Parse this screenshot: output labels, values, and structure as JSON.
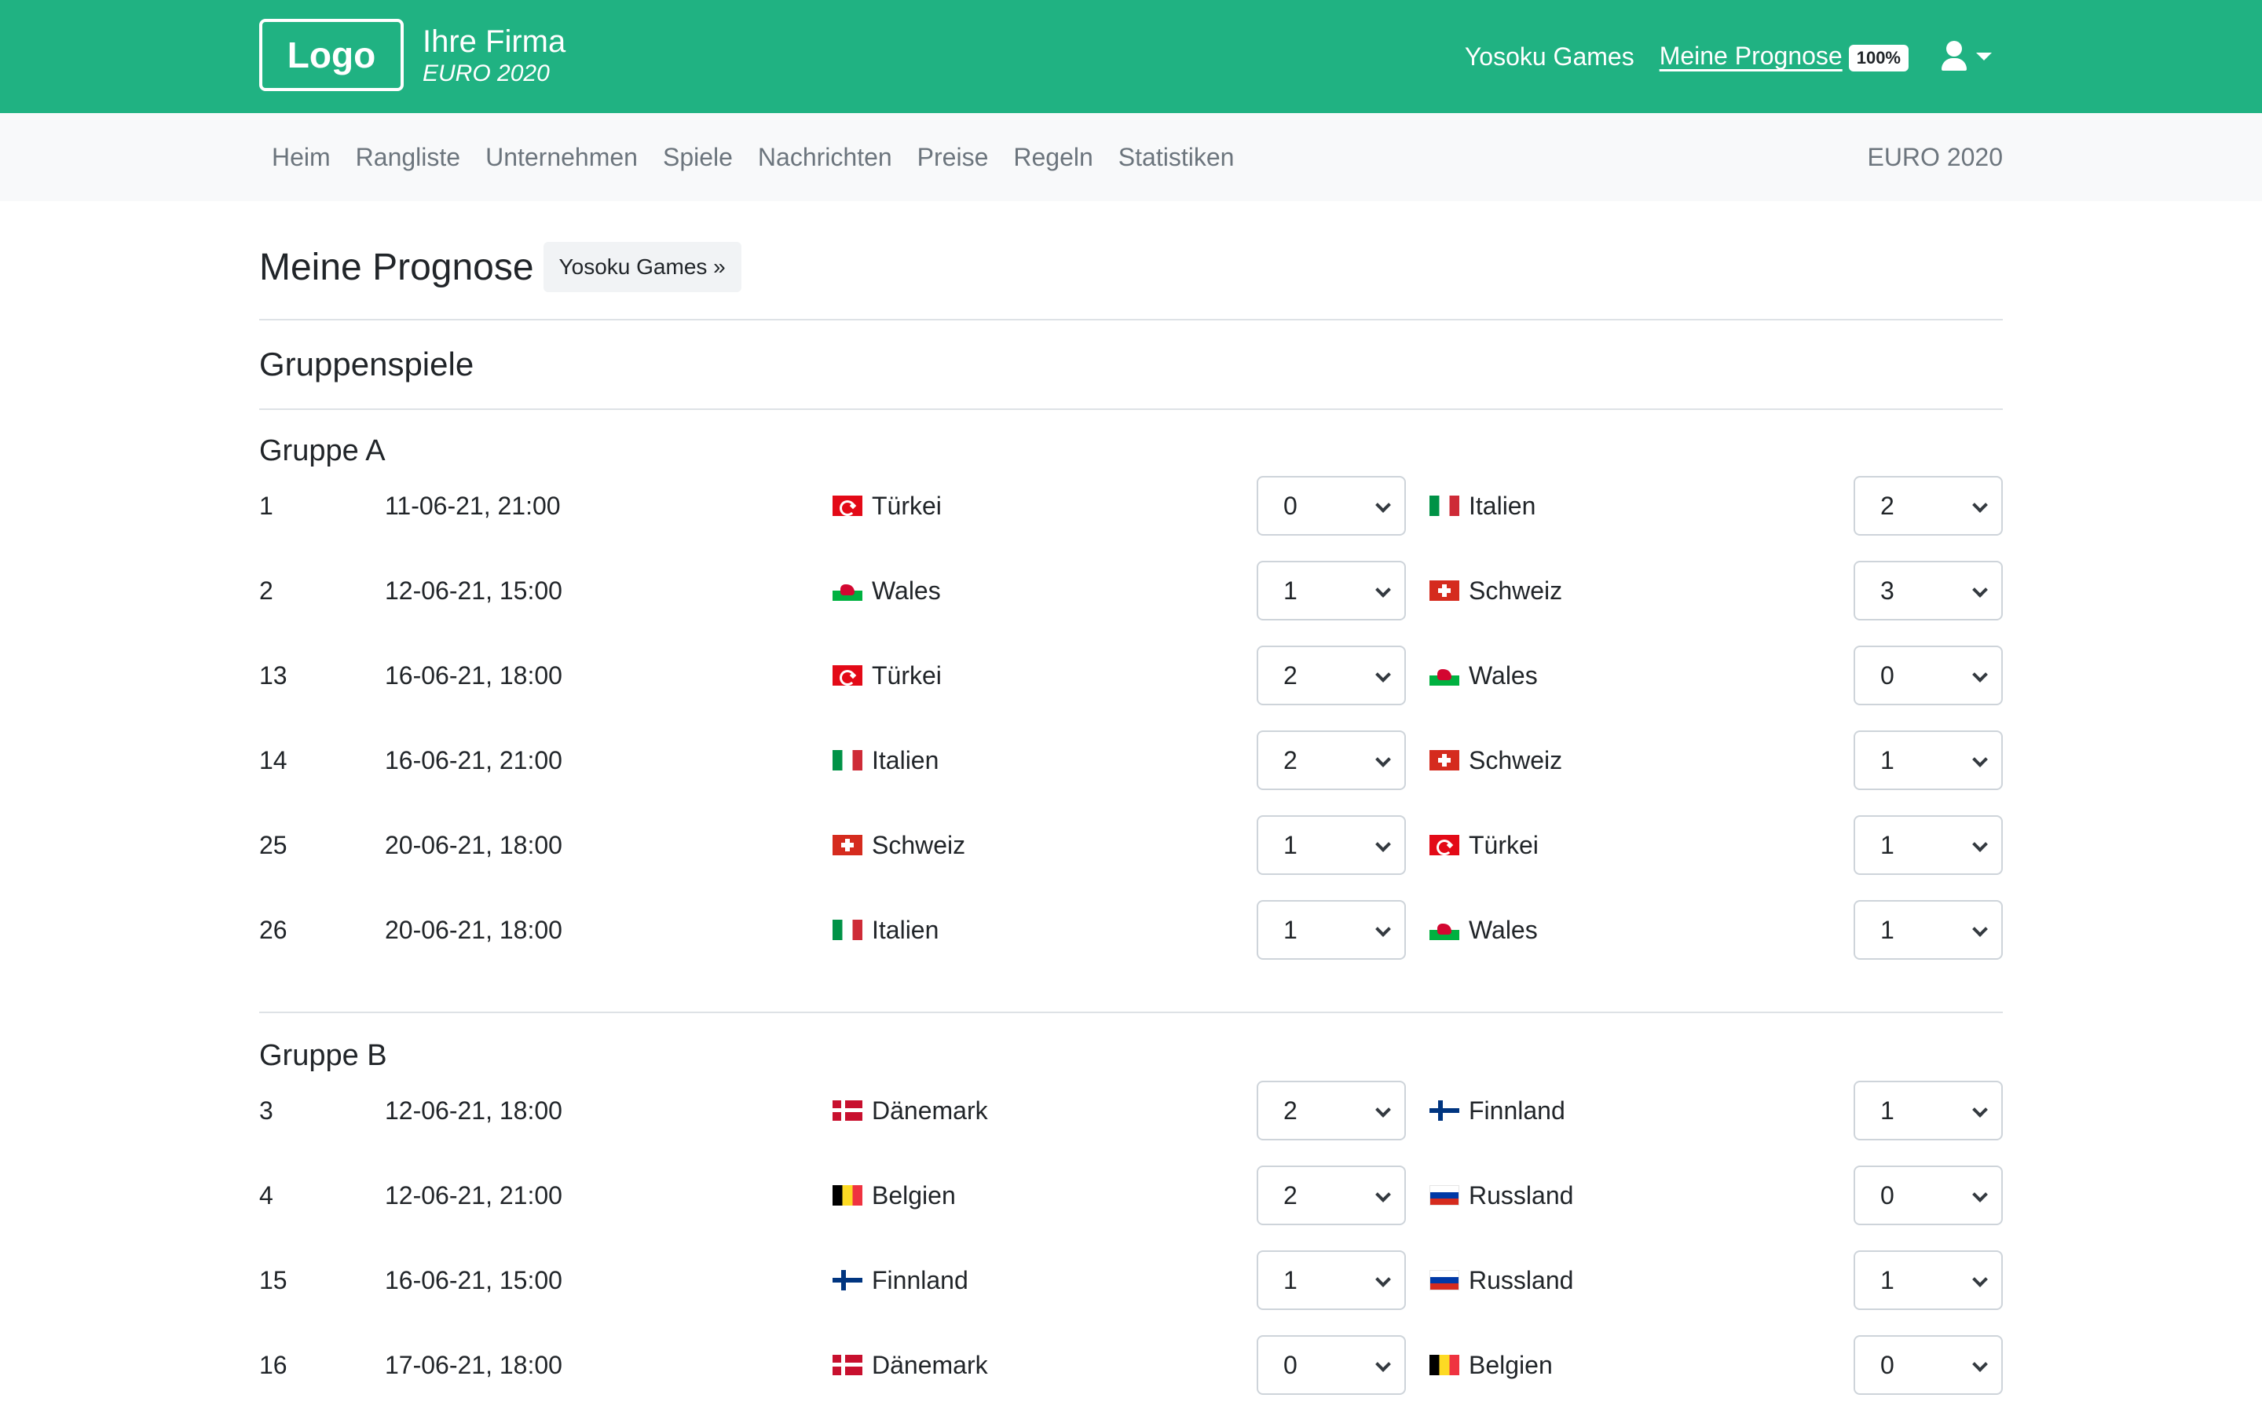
{
  "header": {
    "logo": "Logo",
    "company": "Ihre Firma",
    "tournament": "EURO 2020",
    "links": {
      "games": "Yosoku Games",
      "prognose": "Meine Prognose",
      "progress_badge": "100%"
    },
    "user_icon": "user-icon"
  },
  "subnav": {
    "items": [
      "Heim",
      "Rangliste",
      "Unternehmen",
      "Spiele",
      "Nachrichten",
      "Preise",
      "Regeln",
      "Statistiken"
    ],
    "right": "EURO 2020"
  },
  "page": {
    "title": "Meine Prognose",
    "games_button": "Yosoku Games »",
    "section": "Gruppenspiele"
  },
  "colors": {
    "brand_green": "#20b282",
    "subnav_bg": "#f8f9fa"
  },
  "groups": [
    {
      "title": "Gruppe A",
      "matches": [
        {
          "num": "1",
          "date": "11-06-21, 21:00",
          "home": "Türkei",
          "home_flag": "tr",
          "home_score": "0",
          "away": "Italien",
          "away_flag": "it",
          "away_score": "2"
        },
        {
          "num": "2",
          "date": "12-06-21, 15:00",
          "home": "Wales",
          "home_flag": "wa",
          "home_score": "1",
          "away": "Schweiz",
          "away_flag": "ch",
          "away_score": "3"
        },
        {
          "num": "13",
          "date": "16-06-21, 18:00",
          "home": "Türkei",
          "home_flag": "tr",
          "home_score": "2",
          "away": "Wales",
          "away_flag": "wa",
          "away_score": "0"
        },
        {
          "num": "14",
          "date": "16-06-21, 21:00",
          "home": "Italien",
          "home_flag": "it",
          "home_score": "2",
          "away": "Schweiz",
          "away_flag": "ch",
          "away_score": "1"
        },
        {
          "num": "25",
          "date": "20-06-21, 18:00",
          "home": "Schweiz",
          "home_flag": "ch",
          "home_score": "1",
          "away": "Türkei",
          "away_flag": "tr",
          "away_score": "1"
        },
        {
          "num": "26",
          "date": "20-06-21, 18:00",
          "home": "Italien",
          "home_flag": "it",
          "home_score": "1",
          "away": "Wales",
          "away_flag": "wa",
          "away_score": "1"
        }
      ]
    },
    {
      "title": "Gruppe B",
      "matches": [
        {
          "num": "3",
          "date": "12-06-21, 18:00",
          "home": "Dänemark",
          "home_flag": "dk",
          "home_score": "2",
          "away": "Finnland",
          "away_flag": "fi",
          "away_score": "1"
        },
        {
          "num": "4",
          "date": "12-06-21, 21:00",
          "home": "Belgien",
          "home_flag": "be",
          "home_score": "2",
          "away": "Russland",
          "away_flag": "ru",
          "away_score": "0"
        },
        {
          "num": "15",
          "date": "16-06-21, 15:00",
          "home": "Finnland",
          "home_flag": "fi",
          "home_score": "1",
          "away": "Russland",
          "away_flag": "ru",
          "away_score": "1"
        },
        {
          "num": "16",
          "date": "17-06-21, 18:00",
          "home": "Dänemark",
          "home_flag": "dk",
          "home_score": "0",
          "away": "Belgien",
          "away_flag": "be",
          "away_score": "0"
        }
      ]
    }
  ]
}
